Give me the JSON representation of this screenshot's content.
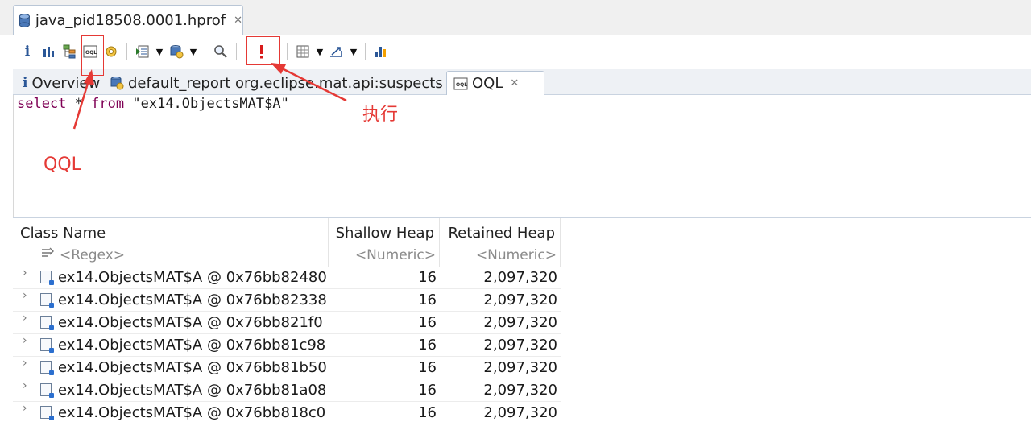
{
  "editor": {
    "tab_title": "java_pid18508.0001.hprof",
    "close_glyph": "✕"
  },
  "toolbar": {
    "buttons": [
      {
        "name": "overview-icon"
      },
      {
        "name": "histogram-icon"
      },
      {
        "name": "dominator-tree-icon"
      },
      {
        "name": "oql-icon"
      },
      {
        "name": "heap-dump-details-icon"
      },
      {
        "name": "run-report-icon"
      },
      {
        "name": "open-query-browser-icon"
      },
      {
        "name": "find-object-icon"
      },
      {
        "name": "execute-icon"
      },
      {
        "name": "calculator-icon"
      },
      {
        "name": "export-icon"
      },
      {
        "name": "grouping-icon"
      }
    ]
  },
  "view_tabs": [
    {
      "label": "Overview"
    },
    {
      "label": "default_report  org.eclipse.mat.api:suspects"
    },
    {
      "label": "OQL"
    }
  ],
  "query": {
    "keyword_select": "select",
    "star": "*",
    "keyword_from": "from",
    "string": "\"ex14.ObjectsMAT$A\""
  },
  "table": {
    "columns": [
      "Class Name",
      "Shallow Heap",
      "Retained Heap"
    ],
    "filters": [
      "<Regex>",
      "<Numeric>",
      "<Numeric>"
    ],
    "rows": [
      {
        "name": "ex14.ObjectsMAT$A @ 0x76bb82480",
        "shallow": "16",
        "retained": "2,097,320"
      },
      {
        "name": "ex14.ObjectsMAT$A @ 0x76bb82338",
        "shallow": "16",
        "retained": "2,097,320"
      },
      {
        "name": "ex14.ObjectsMAT$A @ 0x76bb821f0",
        "shallow": "16",
        "retained": "2,097,320"
      },
      {
        "name": "ex14.ObjectsMAT$A @ 0x76bb81c98",
        "shallow": "16",
        "retained": "2,097,320"
      },
      {
        "name": "ex14.ObjectsMAT$A @ 0x76bb81b50",
        "shallow": "16",
        "retained": "2,097,320"
      },
      {
        "name": "ex14.ObjectsMAT$A @ 0x76bb81a08",
        "shallow": "16",
        "retained": "2,097,320"
      },
      {
        "name": "ex14.ObjectsMAT$A @ 0x76bb818c0",
        "shallow": "16",
        "retained": "2,097,320"
      }
    ]
  },
  "annotations": {
    "qql_label": "QQL",
    "execute_label": "执行",
    "color": "#e53935"
  }
}
